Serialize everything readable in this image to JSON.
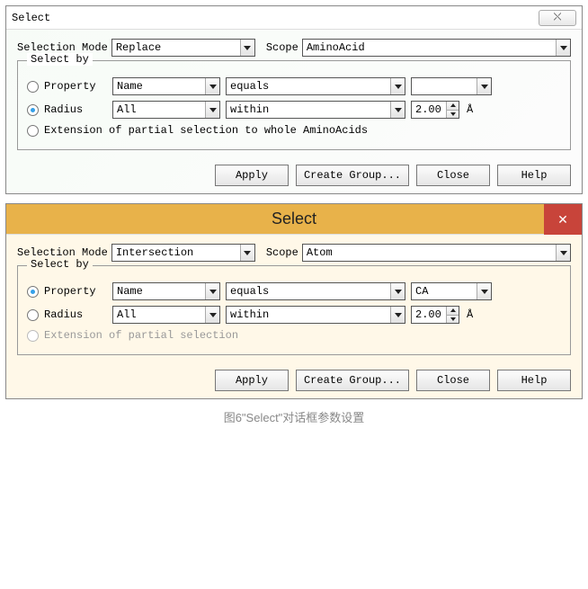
{
  "caption": "图6\"Select\"对话框参数设置",
  "dialog1": {
    "title": "Select",
    "close_glyph": "⤬",
    "selection_mode_label": "Selection Mode",
    "selection_mode_value": "Replace",
    "scope_label": "Scope",
    "scope_value": "AminoAcid",
    "select_by_label": "Select by",
    "property_label": "Property",
    "property_attr_value": "Name",
    "property_op_value": "equals",
    "property_val_value": "",
    "radius_label": "Radius",
    "radius_attr_value": "All",
    "radius_op_value": "within",
    "radius_val_value": "2.00",
    "radius_unit": "Å",
    "extension_label": "Extension of partial selection to whole AminoAcids",
    "buttons": {
      "apply": "Apply",
      "create_group": "Create Group...",
      "close": "Close",
      "help": "Help"
    }
  },
  "dialog2": {
    "title": "Select",
    "close_glyph": "✕",
    "selection_mode_label": "Selection Mode",
    "selection_mode_value": "Intersection",
    "scope_label": "Scope",
    "scope_value": "Atom",
    "select_by_label": "Select by",
    "property_label": "Property",
    "property_attr_value": "Name",
    "property_op_value": "equals",
    "property_val_value": "CA",
    "radius_label": "Radius",
    "radius_attr_value": "All",
    "radius_op_value": "within",
    "radius_val_value": "2.00",
    "radius_unit": "Å",
    "extension_label": "Extension of partial selection",
    "buttons": {
      "apply": "Apply",
      "create_group": "Create Group...",
      "close": "Close",
      "help": "Help"
    }
  }
}
